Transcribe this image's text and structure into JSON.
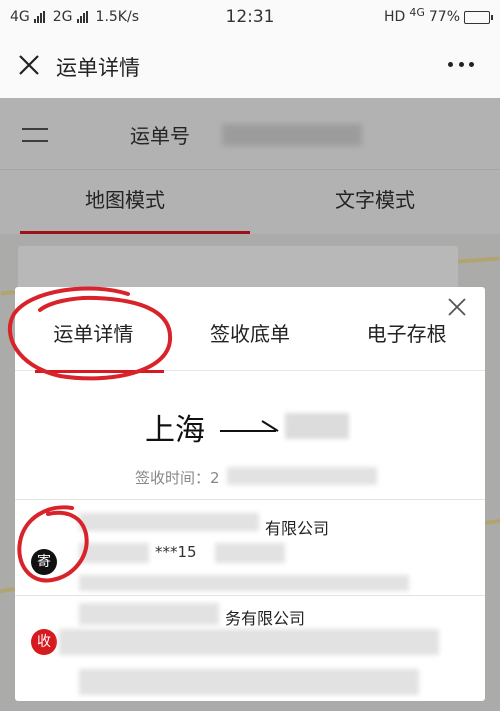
{
  "status_bar": {
    "network1": "4G",
    "network2": "2G",
    "speed": "1.5K/s",
    "time": "12:31",
    "hd": "HD",
    "network3": "4G",
    "battery_percent": "77%",
    "battery_level": 0.77
  },
  "nav": {
    "title": "运单详情"
  },
  "background": {
    "waybill_label": "运单号",
    "tabs": [
      "地图模式",
      "文字模式"
    ]
  },
  "modal": {
    "tabs": [
      {
        "label": "运单详情",
        "active": true
      },
      {
        "label": "签收底单",
        "active": false
      },
      {
        "label": "电子存根",
        "active": false
      }
    ],
    "route_from": "上海",
    "sign_time_label": "签收时间：",
    "sign_time_value": "2",
    "sender": {
      "badge": "寄",
      "company": "有限公司",
      "phone": "***15"
    },
    "receiver": {
      "badge": "收",
      "company": "务有限公司"
    }
  },
  "colors": {
    "accent_red": "#d71920",
    "annotation_red": "#d8232a"
  }
}
